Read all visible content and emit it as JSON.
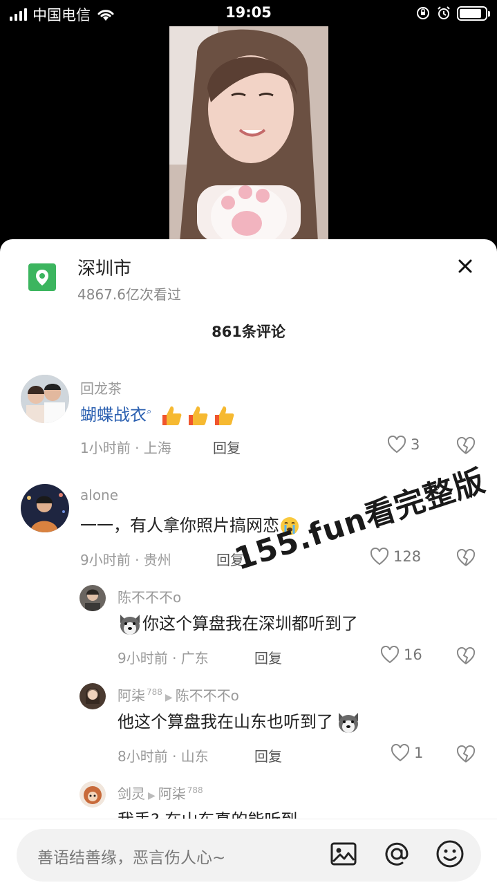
{
  "status_bar": {
    "carrier": "中国电信",
    "time": "19:05",
    "battery_level": 0.85
  },
  "sheet": {
    "location_title": "深圳市",
    "location_views": "4867.6亿次看过",
    "comment_count": "861条评论"
  },
  "comments": [
    {
      "user": "回龙茶",
      "text": "蝴蝶战衣",
      "search_mark": "🔍",
      "emoji": [
        "👍",
        "👍",
        "👍"
      ],
      "time_loc": "1小时前 · 上海",
      "reply_label": "回复",
      "likes": "3"
    },
    {
      "user": "alone",
      "text": "一一，有人拿你照片搞网恋",
      "time_loc": "9小时前 · 贵州",
      "reply_label": "回复",
      "likes": "128"
    },
    {
      "user": "陈不不不o",
      "text": "你这个算盘我在深圳都听到了",
      "time_loc": "9小时前 · 广东",
      "reply_label": "回复",
      "likes": "16"
    },
    {
      "user": "阿柒",
      "user_tag": "788",
      "reply_to": "陈不不不o",
      "text": "他这个算盘我在山东也听到了",
      "time_loc": "8小时前 · 山东",
      "reply_label": "回复",
      "likes": "1"
    },
    {
      "user": "剑灵",
      "reply_to": "阿柒",
      "reply_to_tag": "788",
      "text": "我丢?  在山东真的能听到"
    }
  ],
  "watermark": "155.fun看完整版",
  "input": {
    "placeholder": "善语结善缘，恶言伤人心~"
  },
  "colors": {
    "location_icon": "#3cb55f",
    "link_text": "#2a5fb0"
  }
}
